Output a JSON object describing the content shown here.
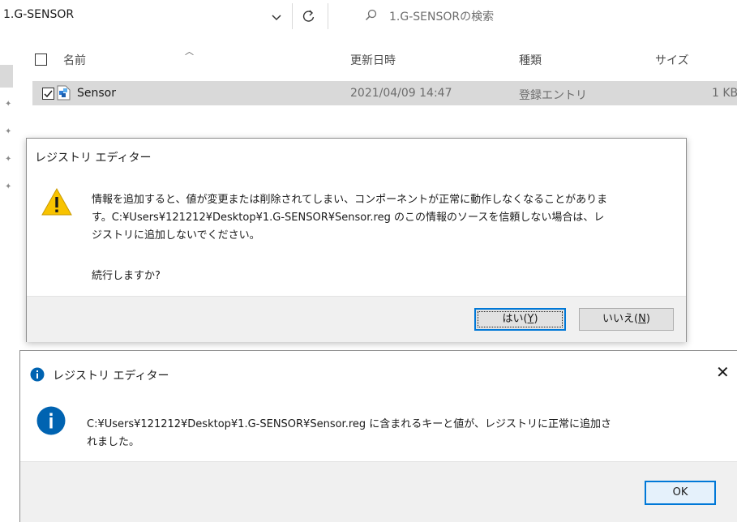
{
  "explorer": {
    "address": "1.G-SENSOR",
    "search_placeholder": "1.G-SENSORの検索",
    "columns": {
      "name": "名前",
      "modified": "更新日時",
      "type": "種類",
      "size": "サイズ"
    },
    "row": {
      "name": "Sensor",
      "modified": "2021/04/09 14:47",
      "type": "登録エントリ",
      "size": "1 KB"
    }
  },
  "confirm_dialog": {
    "title": "レジストリ エディター",
    "icon": "warning-icon",
    "message_line1": "情報を追加すると、値が変更または削除されてしまい、コンポーネントが正常に動作しなくなることがありま",
    "message_line2": "す。C:¥Users¥121212¥Desktop¥1.G-SENSOR¥Sensor.reg のこの情報のソースを信頼しない場合は、レ",
    "message_line3": "ジストリに追加しないでください。",
    "question": "続行しますか?",
    "yes_label": "はい(",
    "yes_key": "Y",
    "yes_close": ")",
    "no_label": "いいえ(",
    "no_key": "N",
    "no_close": ")"
  },
  "result_dialog": {
    "title": "レジストリ エディター",
    "icon": "info-icon",
    "close_glyph": "✕",
    "message_line1": "C:¥Users¥121212¥Desktop¥1.G-SENSOR¥Sensor.reg に含まれるキーと値が、レジストリに正常に追加さ",
    "message_line2": "れました。",
    "ok_label": "OK"
  },
  "colors": {
    "accent": "#0078d7",
    "warning": "#f8c300",
    "info": "#0063b1",
    "selection": "#d9d9d9"
  }
}
